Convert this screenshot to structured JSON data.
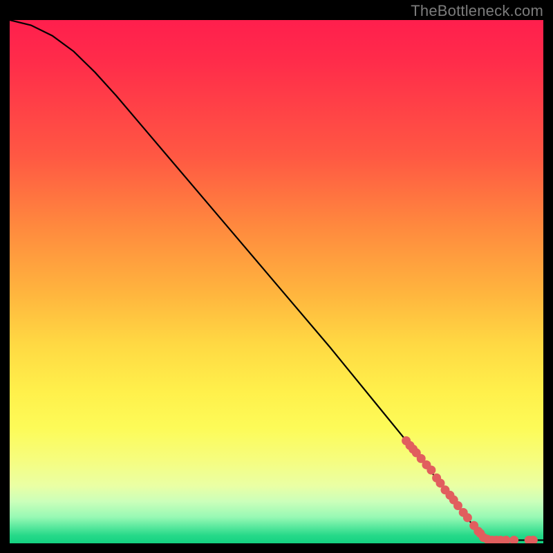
{
  "watermark": "TheBottleneck.com",
  "chart_data": {
    "type": "line",
    "title": "",
    "xlabel": "",
    "ylabel": "",
    "xlim": [
      0,
      100
    ],
    "ylim": [
      0,
      100
    ],
    "curve": [
      {
        "x": 0,
        "y": 100
      },
      {
        "x": 4,
        "y": 99
      },
      {
        "x": 8,
        "y": 97
      },
      {
        "x": 12,
        "y": 94
      },
      {
        "x": 16,
        "y": 90
      },
      {
        "x": 20,
        "y": 85.5
      },
      {
        "x": 25,
        "y": 79.5
      },
      {
        "x": 30,
        "y": 73.5
      },
      {
        "x": 40,
        "y": 61.5
      },
      {
        "x": 50,
        "y": 49.5
      },
      {
        "x": 60,
        "y": 37.5
      },
      {
        "x": 70,
        "y": 25
      },
      {
        "x": 78,
        "y": 15
      },
      {
        "x": 84,
        "y": 7
      },
      {
        "x": 88,
        "y": 2
      },
      {
        "x": 90,
        "y": 0.6
      },
      {
        "x": 100,
        "y": 0.6
      }
    ],
    "markers": [
      {
        "x": 74.3,
        "y": 19.6
      },
      {
        "x": 75.0,
        "y": 18.7
      },
      {
        "x": 75.6,
        "y": 18.0
      },
      {
        "x": 76.2,
        "y": 17.3
      },
      {
        "x": 77.1,
        "y": 16.2
      },
      {
        "x": 78.1,
        "y": 15.0
      },
      {
        "x": 79.0,
        "y": 14.0
      },
      {
        "x": 80.0,
        "y": 12.5
      },
      {
        "x": 80.7,
        "y": 11.5
      },
      {
        "x": 81.6,
        "y": 10.2
      },
      {
        "x": 82.5,
        "y": 9.2
      },
      {
        "x": 83.2,
        "y": 8.3
      },
      {
        "x": 84.0,
        "y": 7.2
      },
      {
        "x": 85.0,
        "y": 5.9
      },
      {
        "x": 85.8,
        "y": 4.9
      },
      {
        "x": 87.0,
        "y": 3.4
      },
      {
        "x": 87.8,
        "y": 2.3
      },
      {
        "x": 88.2,
        "y": 1.9
      },
      {
        "x": 88.8,
        "y": 1.1
      },
      {
        "x": 89.5,
        "y": 0.8
      },
      {
        "x": 90.4,
        "y": 0.6
      },
      {
        "x": 91.2,
        "y": 0.6
      },
      {
        "x": 92.0,
        "y": 0.6
      },
      {
        "x": 93.0,
        "y": 0.6
      },
      {
        "x": 94.5,
        "y": 0.6
      },
      {
        "x": 97.3,
        "y": 0.6
      },
      {
        "x": 98.1,
        "y": 0.6
      }
    ],
    "marker_color": "#e15e5e",
    "line_color": "#000000"
  }
}
